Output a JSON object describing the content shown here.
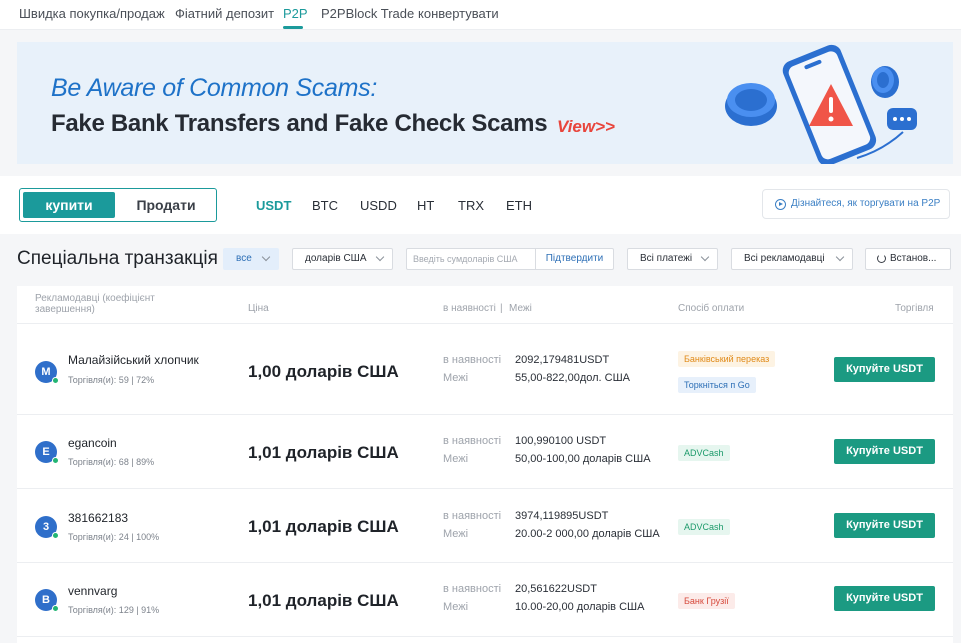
{
  "topnav": {
    "items": [
      "Швидка покупка/продаж",
      "Фіатний депозит",
      "P2P",
      "P2PBlock Trade",
      "конвертувати"
    ],
    "active": "P2P"
  },
  "banner": {
    "title": "Be Aware of Common Scams:",
    "subtitle": "Fake Bank Transfers and Fake Check Scams",
    "link": "View>>"
  },
  "trade": {
    "buy_label": "купити",
    "sell_label": "Продати",
    "coins": [
      "USDT",
      "BTC",
      "USDD",
      "HT",
      "TRX",
      "ETH"
    ],
    "active_coin": "USDT",
    "learn_label": "Дізнайтеся, як торгувати на P2P"
  },
  "filters": {
    "title": "Спеціальна транзакція",
    "type_select": "все",
    "currency_select": "доларів США",
    "amount_placeholder": "Введіть сумдоларів США",
    "confirm_label": "Підтвердити",
    "payments_select": "Всі платежі",
    "advertisers_select": "Всі рекламодавці",
    "refresh_label": "Встанов..."
  },
  "table": {
    "headers": {
      "advertiser": "Рекламодавці (коефіцієнт завершення)",
      "price": "Ціна",
      "available": "в наявності",
      "limits": "Межі",
      "payment": "Спосіб оплати",
      "trade": "Торгівля"
    },
    "available_label": "в наявності",
    "limits_label": "Межі",
    "rows": [
      {
        "avatar": "М",
        "name": "Малайзійський хлопчик",
        "stats": "Торгівля(и): 59 | 72%",
        "price": "1,00 доларів США",
        "available": "2092,179481USDT",
        "limits": "55,00-822,00дол. США",
        "payments": [
          {
            "label": "Банківський переказ",
            "color": "orange"
          },
          {
            "label": "Торкніться п Go",
            "color": "blue"
          }
        ],
        "button": "Купуйте USDT"
      },
      {
        "avatar": "E",
        "name": "egancoin",
        "stats": "Торгівля(и): 68 | 89%",
        "price": "1,01 доларів США",
        "available": "100,990100 USDT",
        "limits": "50,00-100,00 доларів США",
        "payments": [
          {
            "label": "ADVCash",
            "color": "green"
          }
        ],
        "button": "Купуйте USDT"
      },
      {
        "avatar": "3",
        "name": "381662183",
        "stats": "Торгівля(и): 24 | 100%",
        "price": "1,01 доларів США",
        "available": "3974,119895USDT",
        "limits": "20.00-2 000,00 доларів США",
        "payments": [
          {
            "label": "ADVCash",
            "color": "green"
          }
        ],
        "button": "Купуйте USDT"
      },
      {
        "avatar": "B",
        "name": "vennvarg",
        "stats": "Торгівля(и): 129 | 91%",
        "price": "1,01 доларів США",
        "available": "20,561622USDT",
        "limits": "10.00-20,00 доларів США",
        "payments": [
          {
            "label": "Банк Грузії",
            "color": "red"
          }
        ],
        "button": "Купуйте USDT"
      }
    ]
  }
}
